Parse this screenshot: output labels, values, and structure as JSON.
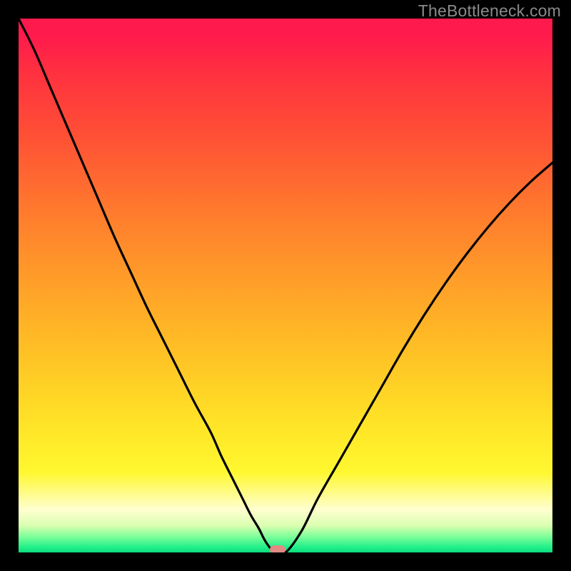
{
  "watermark": "TheBottleneck.com",
  "colors": {
    "frame": "#000000",
    "curve": "#000000",
    "marker": "#e08a83",
    "gradient_top": "#ff1a4d",
    "gradient_yellow": "#ffe427",
    "gradient_bottom": "#0bdc7e"
  },
  "chart_data": {
    "type": "line",
    "title": "",
    "xlabel": "",
    "ylabel": "",
    "xlim": [
      0,
      100
    ],
    "ylim": [
      0,
      100
    ],
    "x": [
      0,
      3,
      6,
      9,
      12,
      15,
      18,
      21,
      24,
      27,
      30,
      33,
      36,
      38,
      40,
      42,
      43.5,
      45,
      46,
      47,
      48,
      50,
      53,
      56,
      60,
      64,
      68,
      72,
      76,
      80,
      84,
      88,
      92,
      96,
      100
    ],
    "y": [
      100,
      94,
      87,
      80,
      73,
      66,
      59,
      52.5,
      46,
      40,
      34,
      28,
      22.5,
      18,
      14,
      10,
      7,
      4.5,
      2.5,
      1,
      0.2,
      0,
      4,
      10,
      17,
      24,
      31,
      38,
      44.5,
      50.5,
      56,
      61,
      65.5,
      69.5,
      73
    ],
    "marker": {
      "x": 48.5,
      "y": 0
    },
    "note": "x and y are in percent of the plot area; y=0 at the bottom (green) edge, y=100 at the top (red) edge. Values estimated from the image."
  }
}
